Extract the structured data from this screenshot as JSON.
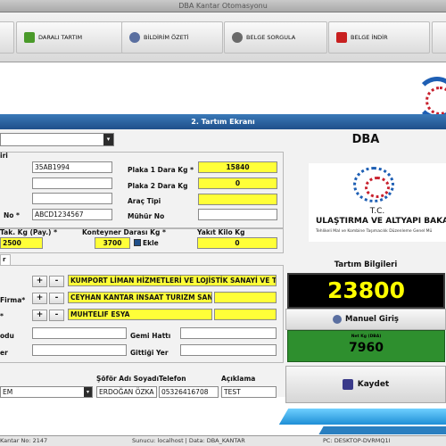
{
  "window": {
    "title": "DBA Kantar Otomasyonu"
  },
  "toolbar": {
    "buttons": [
      {
        "label": "DARALI TARTIM",
        "icon": "download-arrow-icon"
      },
      {
        "label": "BİLDİRİM ÖZETİ",
        "icon": "people-icon"
      },
      {
        "label": "BELGE SORGULA",
        "icon": "search-icon"
      },
      {
        "label": "BELGE İNDİR",
        "icon": "pdf-icon"
      }
    ]
  },
  "form": {
    "title": "2. Tartım Ekranı",
    "group1_label": "iri",
    "plaka_value": "35AB1994",
    "field_blank_1": "",
    "field_blank_2": "",
    "konteyner_no_label": "No *",
    "konteyner_no_value": "ABCD1234567",
    "plaka1_dara_label": "Plaka 1 Dara Kg *",
    "plaka1_dara_value": "15840",
    "plaka2_dara_label": "Plaka 2 Dara Kg",
    "plaka2_dara_value": "0",
    "arac_tipi_label": "Araç Tipi",
    "arac_tipi_value": "",
    "muhur_no_label": "Mühür No",
    "muhur_no_value": "",
    "paket_label": "Tak. Kg (Pay.) *",
    "paket_value": "2500",
    "konteyner_dara_label": "Konteyner Darası Kg *",
    "konteyner_dara_value": "3700",
    "ekle_label": "Ekle",
    "yakit_label": "Yakıt Kilo Kg",
    "yakit_value": "0",
    "tab_label": "r",
    "row1_value": "KUMPORT LİMAN HİZMETLERİ VE LOJİSTİK SANAYİ VE Tİ",
    "row2_label": "Firma*",
    "row2_value": "CEYHAN KANTAR INSAAT TURIZM SANA",
    "row3_label": "*",
    "row3_value": "MUHTELIF ESYA",
    "kodu_label": "odu",
    "kodu_value": "",
    "gemi_hatti_label": "Gemi Hattı",
    "gemi_hatti_value": "",
    "er_label": "er",
    "er_value": "",
    "gittigi_yer_label": "Gittiği Yer",
    "gittigi_yer_value": "",
    "plus_label": "+",
    "minus_label": "-",
    "sofor_label": "Şöför Adı Soyadı",
    "sofor_value": "ERDOĞAN ÖZKA",
    "telefon_label": "Telefon",
    "telefon_value": "05326416708",
    "aciklama_label": "Açıklama",
    "aciklama_value": "TEST",
    "select_value": "EM"
  },
  "right": {
    "company": "DBA",
    "logo_tc": "T.C.",
    "logo_name": "ULAŞTIRMA VE ALTYAPI BAKAN",
    "logo_sub": "Tehlikeli Mal ve Kombine Taşımacılık Düzenleme Genel Mü",
    "tartim_bilgileri": "Tartım Bilgileri",
    "weight": "23800",
    "manuel_giris": "Manuel Giriş",
    "net_label": "Net Kg (DBA)",
    "net_value": "7960",
    "kaydet": "Kaydet"
  },
  "status": {
    "left": "Kantar No: 2147",
    "middle": "Sunucu: localhost | Data: DBA_KANTAR",
    "right": "PC: DESKTOP-DVRMQ1I"
  },
  "colors": {
    "accent": "#1f4f8a",
    "highlight": "#ffff38",
    "net_green": "#2e8f2e",
    "display_bg": "#000000",
    "display_fg": "#ffff00"
  }
}
